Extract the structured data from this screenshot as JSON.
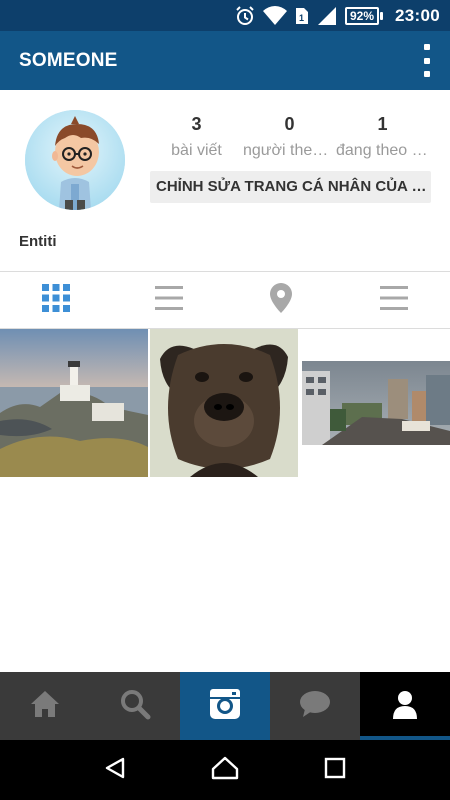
{
  "status_bar": {
    "battery": "92%",
    "time": "23:00"
  },
  "app_bar": {
    "title": "SOMEONE"
  },
  "profile": {
    "username": "Entiti",
    "stats": [
      {
        "count": "3",
        "label": "bài viết"
      },
      {
        "count": "0",
        "label": "người theo dõi"
      },
      {
        "count": "1",
        "label": "đang theo dõi"
      }
    ],
    "edit_button": "CHỈNH SỬA TRANG CÁ NHÂN CỦA BẠN"
  },
  "view_tabs": [
    "grid-view-icon",
    "list-view-icon",
    "location-pin-icon",
    "tagged-list-icon"
  ],
  "photos": [
    "lighthouse-photo",
    "dog-photo",
    "city-street-photo"
  ],
  "bottom_nav": [
    "home-icon",
    "search-icon",
    "camera-icon",
    "activity-icon",
    "profile-icon"
  ],
  "colors": {
    "status_bar": "#0d3f6b",
    "app_bar": "#125688",
    "accent": "#3d8fd6",
    "bottom_nav": "#3a3a3a"
  }
}
